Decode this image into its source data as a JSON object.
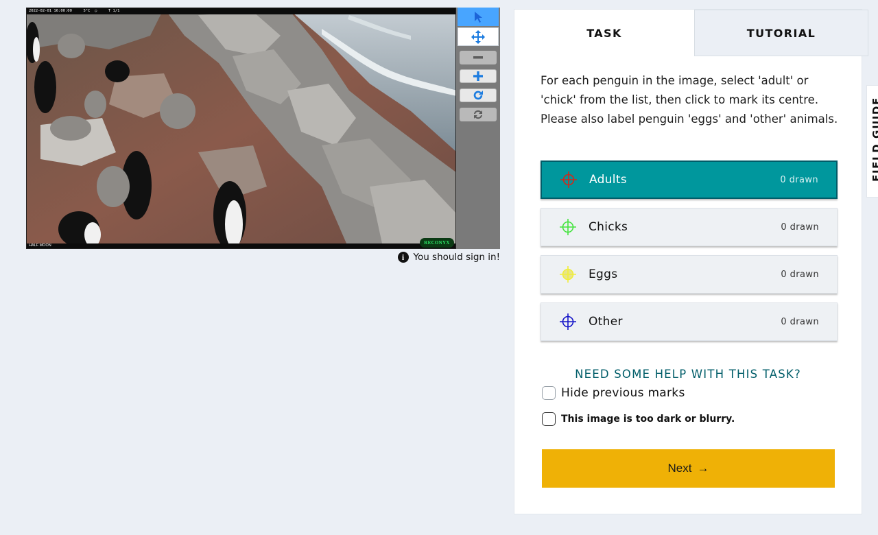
{
  "viewer": {
    "image_timestamp": "2022-02-01 16:00:00     5°C  ○     T 1/1",
    "camera_name": "HALF MOON",
    "brand_logo_text": "RECONYX",
    "tools": [
      {
        "name": "pointer-tool",
        "icon": "arrow-pointer-icon"
      },
      {
        "name": "move-tool",
        "icon": "four-way-arrows-icon"
      },
      {
        "name": "zoom-out-button",
        "icon": "minus-icon"
      },
      {
        "name": "zoom-in-button",
        "icon": "plus-icon"
      },
      {
        "name": "rotate-button",
        "icon": "rotate-icon"
      },
      {
        "name": "reset-button",
        "icon": "refresh-icon"
      }
    ],
    "signin_notice": "You should sign in!"
  },
  "tabs": [
    {
      "label": "TASK",
      "active": true
    },
    {
      "label": "TUTORIAL",
      "active": false
    }
  ],
  "instructions": "For each penguin in the image, select 'adult' or 'chick' from the list, then click to mark its centre. Please also label penguin 'eggs' and 'other' animals.",
  "choices": [
    {
      "label": "Adults",
      "count": "0 drawn",
      "color": "#d1281b",
      "active": true
    },
    {
      "label": "Chicks",
      "count": "0 drawn",
      "color": "#43e33d",
      "active": false
    },
    {
      "label": "Eggs",
      "count": "0 drawn",
      "color": "#f0ee3a",
      "active": false
    },
    {
      "label": "Other",
      "count": "0 drawn",
      "color": "#1414c8",
      "active": false
    }
  ],
  "help_link": "NEED SOME HELP WITH THIS TASK?",
  "hide_marks_label": "Hide previous marks",
  "too_dark_label": "This image is too dark or blurry.",
  "next_button": {
    "label": "Next",
    "arrow": "→"
  },
  "field_guide_label": "FIELD GUIDE",
  "colors": {
    "accent_teal": "#00979d",
    "next_yellow": "#efb106",
    "help_text": "#005d69",
    "tool_active_blue": "#48a5ff"
  }
}
